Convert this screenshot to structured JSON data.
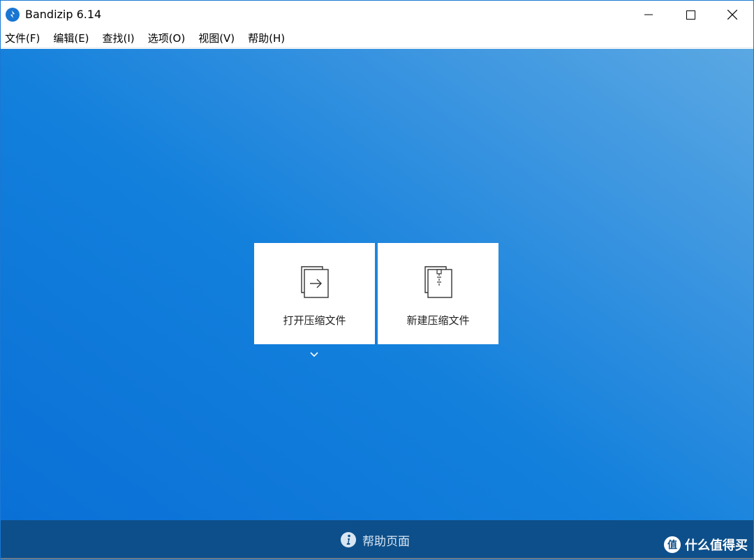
{
  "window": {
    "title": "Bandizip 6.14",
    "logo_icon": "bandizip-logo-icon",
    "controls": [
      "minimize-icon",
      "maximize-icon",
      "close-icon"
    ]
  },
  "menu": {
    "items": [
      {
        "label": "文件(F)"
      },
      {
        "label": "编辑(E)"
      },
      {
        "label": "查找(I)"
      },
      {
        "label": "选项(O)"
      },
      {
        "label": "视图(V)"
      },
      {
        "label": "帮助(H)"
      }
    ]
  },
  "main": {
    "open_card": {
      "label": "打开压缩文件",
      "icon": "open-archive-icon"
    },
    "new_card": {
      "label": "新建压缩文件",
      "icon": "new-archive-icon"
    },
    "dropdown_icon": "chevron-down-icon"
  },
  "footer": {
    "help_label": "帮助页面",
    "help_icon": "info-icon",
    "watermark_text": "什么值得买",
    "watermark_logo": "值"
  },
  "colors": {
    "accent": "#1976d2",
    "footer": "#0d4f8a",
    "gradient_start": "#0a70d6",
    "gradient_end": "#5aa8e3"
  }
}
